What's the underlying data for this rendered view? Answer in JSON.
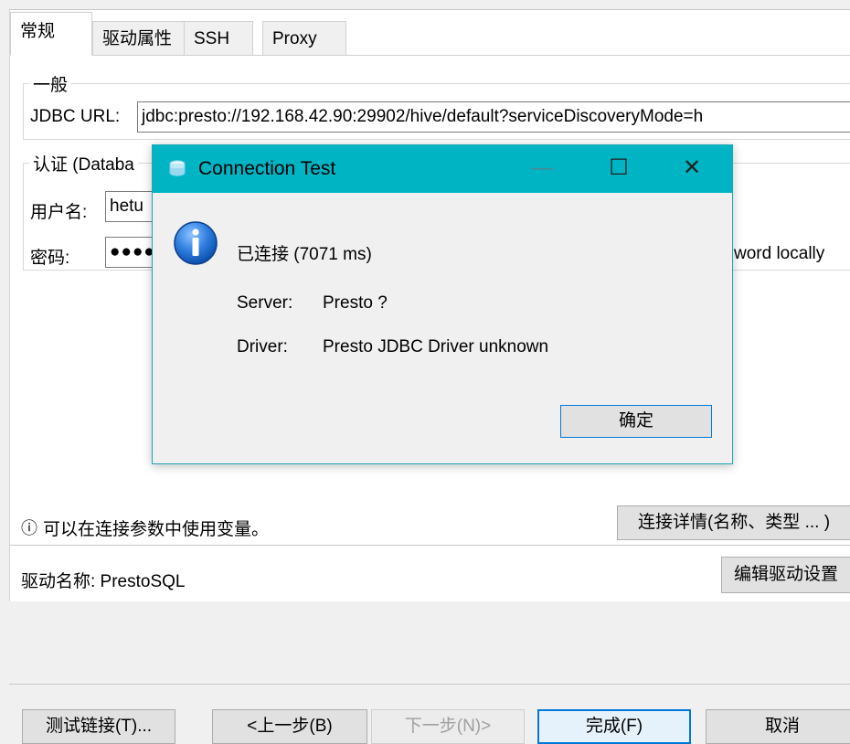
{
  "tabs": [
    {
      "label": "常规"
    },
    {
      "label": "驱动属性"
    },
    {
      "label": "SSH"
    },
    {
      "label": "Proxy"
    }
  ],
  "general": {
    "title": "一般",
    "jdbc_label": "JDBC URL:",
    "jdbc_value": "jdbc:presto://192.168.42.90:29902/hive/default?serviceDiscoveryMode=h"
  },
  "auth": {
    "title": "认证 (Databa",
    "username_label": "用户名:",
    "username_value": "hetu",
    "password_label": "密码:",
    "password_value": "●●●●",
    "save_password_text": "word locally"
  },
  "info": {
    "icon_text": "ⓘ",
    "text": "可以在连接参数中使用变量。",
    "details_button": "连接详情(名称、类型 ... )"
  },
  "driver": {
    "label": "驱动名称: PrestoSQL",
    "edit_button": "编辑驱动设置"
  },
  "bottom_buttons": {
    "test": "测试链接(T)...",
    "back": "<上一步(B)",
    "next": "下一步(N)>",
    "finish": "完成(F)",
    "cancel": "取消"
  },
  "dialog": {
    "title": "Connection Test",
    "status": "已连接 (7071 ms)",
    "server_label": "Server:",
    "server_value": "Presto ?",
    "driver_label": "Driver:",
    "driver_value": "Presto JDBC Driver unknown",
    "ok_button": "确定",
    "controls": {
      "minimize": "—",
      "maximize": "☐",
      "close": "✕"
    }
  },
  "colors": {
    "dialog_title_bar": "#00b4c4",
    "primary_button_border": "#0078d7",
    "info_icon": "#1e6fd0"
  }
}
